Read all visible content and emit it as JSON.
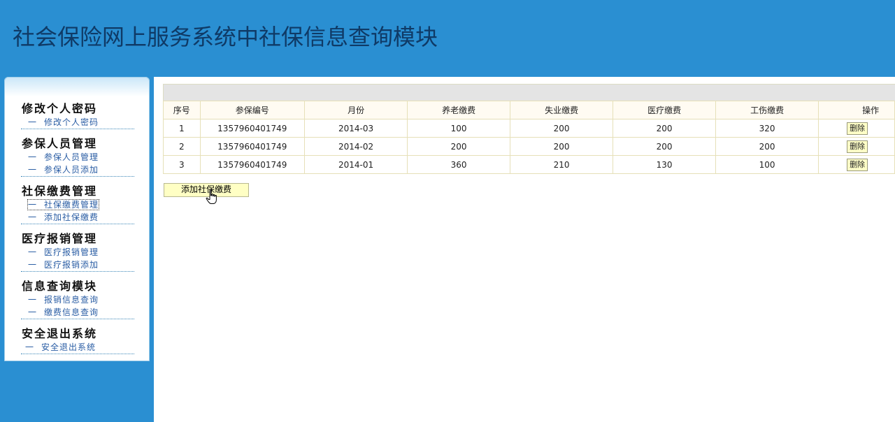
{
  "header": {
    "title": "社会保险网上服务系统中社保信息查询模块"
  },
  "sidebar": {
    "groups": [
      {
        "heading": "修改个人密码",
        "items": [
          {
            "label": "修改个人密码",
            "active": false
          }
        ]
      },
      {
        "heading": "参保人员管理",
        "items": [
          {
            "label": "参保人员管理",
            "active": false
          },
          {
            "label": "参保人员添加",
            "active": false
          }
        ]
      },
      {
        "heading": "社保缴费管理",
        "items": [
          {
            "label": "社保缴费管理",
            "active": true
          },
          {
            "label": "添加社保缴费",
            "active": false
          }
        ]
      },
      {
        "heading": "医疗报销管理",
        "items": [
          {
            "label": "医疗报销管理",
            "active": false
          },
          {
            "label": "医疗报销添加",
            "active": false
          }
        ]
      },
      {
        "heading": "信息查询模块",
        "items": [
          {
            "label": "报销信息查询",
            "active": false
          },
          {
            "label": "缴费信息查询",
            "active": false
          }
        ]
      },
      {
        "heading": "安全退出系统",
        "items": [
          {
            "label": "安全退出系统",
            "active": false
          }
        ]
      }
    ],
    "item_prefix": "一"
  },
  "table": {
    "columns": [
      "序号",
      "参保编号",
      "月份",
      "养老缴费",
      "失业缴费",
      "医疗缴费",
      "工伤缴费",
      "操作"
    ],
    "rows": [
      {
        "index": "1",
        "insured_id": "1357960401749",
        "month": "2014-03",
        "pension": "100",
        "unemployment": "200",
        "medical": "200",
        "injury": "320"
      },
      {
        "index": "2",
        "insured_id": "1357960401749",
        "month": "2014-02",
        "pension": "200",
        "unemployment": "200",
        "medical": "200",
        "injury": "200"
      },
      {
        "index": "3",
        "insured_id": "1357960401749",
        "month": "2014-01",
        "pension": "360",
        "unemployment": "210",
        "medical": "130",
        "injury": "100"
      }
    ],
    "delete_label": "删除"
  },
  "add_button": {
    "label": "添加社保缴费"
  },
  "colors": {
    "header_bg": "#2a8fd2",
    "title_color": "#0f3a66",
    "button_bg": "#ffffc4"
  }
}
